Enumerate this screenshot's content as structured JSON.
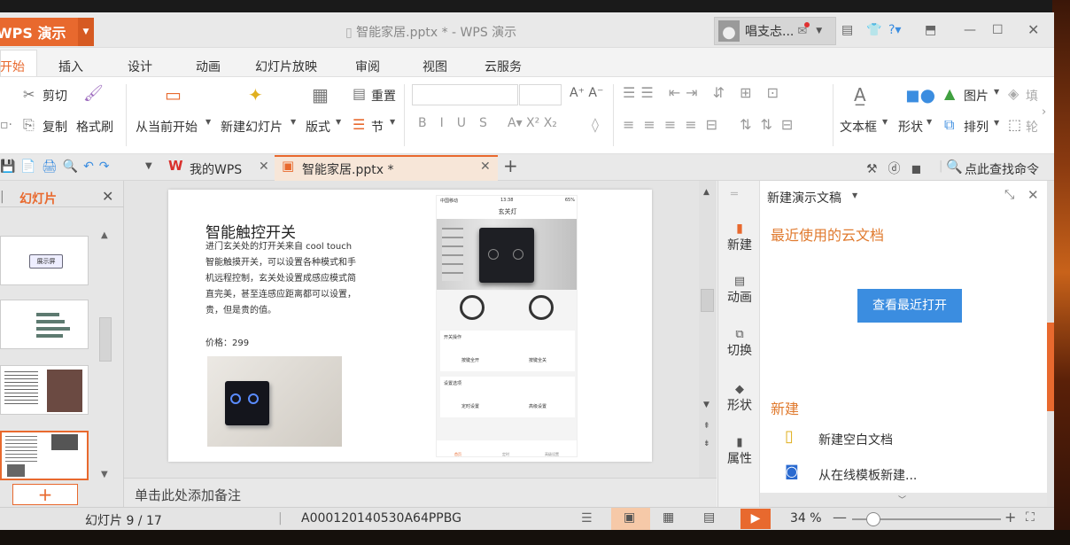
{
  "app": {
    "logo_label": "WPS 演示",
    "title": "智能家居.pptx * - WPS 演示",
    "username": "唱支忐..."
  },
  "menu": [
    "开始",
    "插入",
    "设计",
    "动画",
    "幻灯片放映",
    "审阅",
    "视图",
    "云服务"
  ],
  "ribbon": {
    "cut": "剪切",
    "copy": "复制",
    "format_painter": "格式刷",
    "from_current": "从当前开始",
    "new_slide": "新建幻灯片",
    "layout": "版式",
    "reset": "重置",
    "section": "节",
    "text_box": "文本框",
    "shape": "形状",
    "picture": "图片",
    "arrange": "排列",
    "fill": "填",
    "outline": "轮"
  },
  "doc_tabs": {
    "home_tab": "我的WPS",
    "doc_tab": "智能家居.pptx *",
    "search": "点此查找命令"
  },
  "slides_panel": {
    "title": "幻灯片",
    "thumb1_text": "展示屏"
  },
  "slide": {
    "heading": "智能触控开关",
    "body": "进门玄关处的灯开关来自 cool touch 智能触摸开关，可以设置各种模式和手机远程控制，玄关处设置成感应模式简直完美，甚至连感应距离都可以设置，贵，但是贵的值。",
    "price": "价格：299",
    "phone": {
      "status_left": "中国移动",
      "status_time": "13:38",
      "status_right": "65%",
      "title": "玄关灯",
      "section1": "开关操作",
      "btn_on": "按键全开",
      "btn_off": "按键全关",
      "section2": "设置选项",
      "btn_timer": "定时设置",
      "btn_advanced": "高级设置",
      "nav1": "首页",
      "nav2": "定时",
      "nav3": "高级设置"
    }
  },
  "notes_placeholder": "单击此处添加备注",
  "side_tabs": [
    "新建",
    "动画",
    "切换",
    "形状",
    "属性"
  ],
  "panel": {
    "title": "新建演示文稿",
    "recent_heading": "最近使用的云文档",
    "view_recent_button": "查看最近打开",
    "new_heading": "新建",
    "new_blank": "新建空白文档",
    "new_from_template": "从在线模板新建..."
  },
  "status": {
    "slide_info": "幻灯片 9 / 17",
    "doc_id": "A000120140530A64PPBG",
    "zoom": "34 %",
    "zoom_level": 0.34
  },
  "colors": {
    "accent": "#e8692e",
    "blue_button": "#3b8de0",
    "panel_heading": "#e07a2e"
  }
}
